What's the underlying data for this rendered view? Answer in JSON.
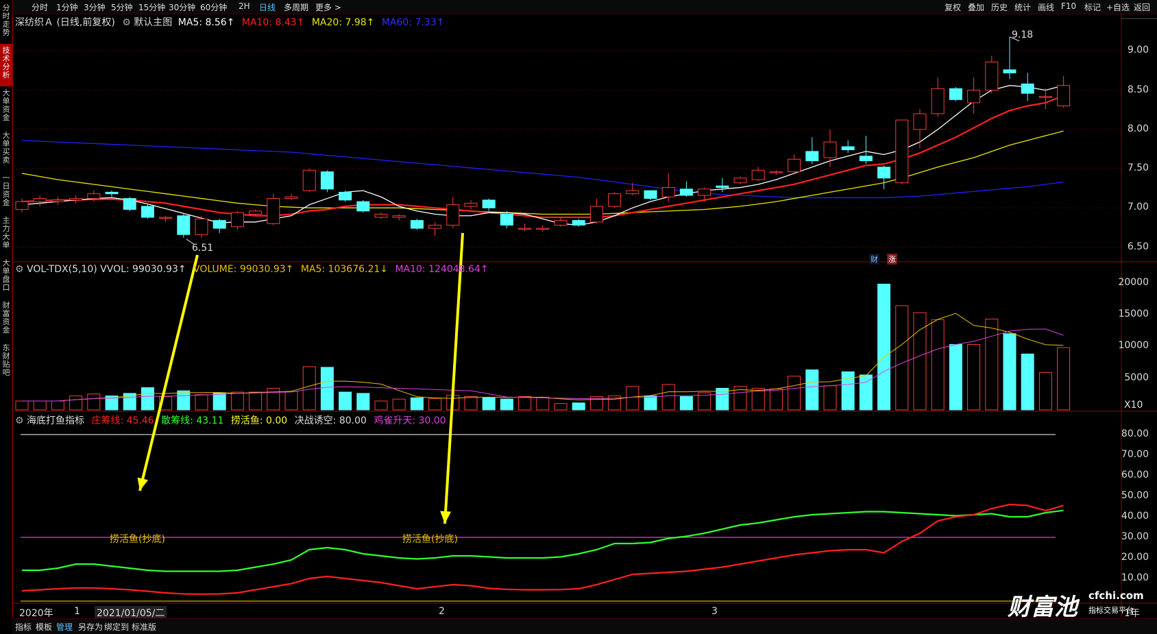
{
  "toolbar": {
    "timeframes": [
      "分时",
      "1分钟",
      "3分钟",
      "5分钟",
      "15分钟",
      "30分钟",
      "60分钟",
      "2H",
      "日线",
      "多周期",
      "更多 >"
    ],
    "active_timeframe": "日线",
    "right_buttons": [
      "复权",
      "叠加",
      "历史",
      "统计",
      "画线",
      "F10",
      "标记",
      "+自选",
      "返回"
    ]
  },
  "sidebar": {
    "items": [
      {
        "label": "分时走势",
        "active": false
      },
      {
        "label": "技术分析",
        "active": true
      },
      {
        "label": "大单资金",
        "active": false
      },
      {
        "label": "大单买卖",
        "active": false
      },
      {
        "label": "一日资金",
        "active": false
      },
      {
        "label": "主力大单",
        "active": false
      },
      {
        "label": "大单盘口",
        "active": false
      },
      {
        "label": "财富资金",
        "active": false
      },
      {
        "label": "东财贴吧",
        "active": false
      }
    ]
  },
  "price_panel": {
    "stock_name": "深纺织Ａ (日线,前复权)",
    "template": "默认主图",
    "ma5": "MA5: 8.56↑",
    "ma10": "MA10: 8.43↑",
    "ma20": "MA20: 7.98↑",
    "ma60": "MA60: 7.33↑",
    "axis": [
      "9.00",
      "8.50",
      "8.00",
      "7.50",
      "7.00",
      "6.50"
    ],
    "high_label": "9.18",
    "low_label": "6.51",
    "badges": [
      "财",
      "涨"
    ],
    "colors": {
      "up": "#ff3b3b",
      "down": "#54ffff",
      "ma5": "#ffffff",
      "ma10": "#ff2020",
      "ma20": "#e8e800",
      "ma60": "#2020ff"
    }
  },
  "volume_panel": {
    "title": "VOL-TDX(5,10) VVOL: 99030.93↑",
    "volume": "VOLUME: 99030.93↑",
    "ma5": "MA5: 103676.21↓",
    "ma10": "MA10: 124048.64↑",
    "axis": [
      "20000",
      "15000",
      "10000",
      "5000"
    ],
    "unit": "X10"
  },
  "indicator_panel": {
    "title": "海底打鱼指标",
    "zhuang": "庄筹线: 45.46",
    "san": "散筹线: 43.11",
    "laohuo": "捞活鱼: 0.00",
    "juezhan": "决战诱空: 80.00",
    "jique": "鸡雀升天: 30.00",
    "axis": [
      "80.00",
      "70.00",
      "60.00",
      "50.00",
      "40.00",
      "30.00",
      "20.00",
      "10.00"
    ],
    "annotation_label": "捞活鱼(抄底)",
    "annotations": [
      "捞活鱼(抄底)",
      "捞活鱼(抄底)"
    ]
  },
  "xaxis": {
    "labels": [
      "2020年",
      "1",
      "2021/01/05/二",
      "2",
      "3"
    ],
    "corner": "1年"
  },
  "bottom_tabs": [
    "指标",
    "模板",
    "管理",
    "另存为",
    "绑定到",
    "标准版"
  ],
  "active_bottom_tab": "管理",
  "watermark": {
    "brand": "财富池",
    "site": "cfchi.com",
    "slogan": "指标交易平台"
  },
  "chart_data": {
    "type": "candlestick",
    "candles": [
      [
        6.98,
        7.08,
        6.94,
        7.12
      ],
      [
        7.08,
        7.12,
        7.02,
        7.16
      ],
      [
        7.08,
        7.1,
        7.04,
        7.14
      ],
      [
        7.1,
        7.12,
        7.06,
        7.16
      ],
      [
        7.12,
        7.18,
        7.08,
        7.22
      ],
      [
        7.2,
        7.18,
        7.14,
        7.22
      ],
      [
        7.12,
        6.98,
        6.96,
        7.14
      ],
      [
        7.02,
        6.88,
        6.86,
        7.04
      ],
      [
        6.88,
        6.88,
        6.82,
        6.9
      ],
      [
        6.9,
        6.66,
        6.62,
        6.92
      ],
      [
        6.66,
        6.86,
        6.62,
        6.9
      ],
      [
        6.84,
        6.74,
        6.68,
        6.86
      ],
      [
        6.76,
        6.94,
        6.72,
        6.96
      ],
      [
        6.92,
        6.96,
        6.9,
        6.98
      ],
      [
        6.8,
        7.12,
        6.78,
        7.18
      ],
      [
        7.12,
        7.14,
        7.1,
        7.18
      ],
      [
        7.22,
        7.48,
        7.2,
        7.5
      ],
      [
        7.46,
        7.24,
        7.2,
        7.48
      ],
      [
        7.2,
        7.1,
        7.08,
        7.22
      ],
      [
        7.08,
        6.96,
        6.94,
        7.1
      ],
      [
        6.88,
        6.92,
        6.86,
        6.94
      ],
      [
        6.88,
        6.9,
        6.84,
        6.92
      ],
      [
        6.84,
        6.74,
        6.72,
        6.86
      ],
      [
        6.74,
        6.78,
        6.64,
        6.82
      ],
      [
        6.78,
        7.04,
        6.74,
        7.14
      ],
      [
        7.02,
        7.06,
        6.98,
        7.1
      ],
      [
        7.1,
        7.0,
        6.96,
        7.12
      ],
      [
        6.92,
        6.78,
        6.74,
        6.96
      ],
      [
        6.74,
        6.74,
        6.7,
        6.8
      ],
      [
        6.74,
        6.74,
        6.7,
        6.78
      ],
      [
        6.78,
        6.84,
        6.76,
        6.88
      ],
      [
        6.84,
        6.78,
        6.76,
        6.86
      ],
      [
        6.82,
        7.02,
        6.8,
        7.12
      ],
      [
        7.02,
        7.18,
        7.0,
        7.2
      ],
      [
        7.18,
        7.22,
        7.16,
        7.32
      ],
      [
        7.22,
        7.12,
        7.1,
        7.22
      ],
      [
        7.14,
        7.26,
        7.08,
        7.44
      ],
      [
        7.24,
        7.16,
        7.14,
        7.34
      ],
      [
        7.16,
        7.24,
        7.08,
        7.26
      ],
      [
        7.28,
        7.26,
        7.2,
        7.38
      ],
      [
        7.32,
        7.38,
        7.3,
        7.4
      ],
      [
        7.36,
        7.48,
        7.34,
        7.52
      ],
      [
        7.46,
        7.46,
        7.42,
        7.48
      ],
      [
        7.46,
        7.62,
        7.44,
        7.68
      ],
      [
        7.72,
        7.6,
        7.56,
        7.9
      ],
      [
        7.64,
        7.84,
        7.52,
        8.0
      ],
      [
        7.78,
        7.74,
        7.7,
        7.86
      ],
      [
        7.66,
        7.6,
        7.56,
        7.92
      ],
      [
        7.52,
        7.38,
        7.24,
        7.54
      ],
      [
        7.32,
        8.12,
        7.3,
        8.12
      ],
      [
        8.0,
        8.2,
        7.76,
        8.26
      ],
      [
        8.2,
        8.52,
        8.16,
        8.66
      ],
      [
        8.52,
        8.38,
        8.36,
        8.54
      ],
      [
        8.34,
        8.5,
        8.2,
        8.66
      ],
      [
        8.5,
        8.86,
        8.46,
        8.94
      ],
      [
        8.76,
        8.72,
        8.64,
        9.18
      ],
      [
        8.58,
        8.46,
        8.36,
        8.72
      ],
      [
        8.42,
        8.42,
        8.26,
        8.52
      ],
      [
        8.3,
        8.56,
        8.28,
        8.68
      ]
    ],
    "volumes": [
      14,
      14,
      14,
      22,
      25,
      22,
      26,
      35,
      21,
      30,
      24,
      27,
      28,
      28,
      34,
      29,
      68,
      67,
      28,
      26,
      14,
      17,
      19,
      18,
      23,
      21,
      19,
      17,
      21,
      20,
      10,
      11,
      21,
      22,
      37,
      22,
      40,
      21,
      27,
      34,
      37,
      34,
      33,
      53,
      63,
      38,
      60,
      55,
      198,
      164,
      153,
      142,
      103,
      103,
      143,
      120,
      88,
      59,
      98
    ],
    "ma5": [
      7.04,
      7.06,
      7.08,
      7.1,
      7.12,
      7.13,
      7.1,
      7.05,
      6.99,
      6.93,
      6.87,
      6.81,
      6.82,
      6.82,
      6.86,
      6.9,
      7.04,
      7.12,
      7.2,
      7.22,
      7.14,
      7.02,
      6.96,
      6.92,
      6.9,
      6.9,
      6.94,
      6.94,
      6.92,
      6.86,
      6.8,
      6.78,
      6.82,
      6.9,
      7.0,
      7.08,
      7.14,
      7.18,
      7.22,
      7.24,
      7.26,
      7.3,
      7.36,
      7.44,
      7.52,
      7.6,
      7.66,
      7.72,
      7.68,
      7.74,
      7.84,
      8.0,
      8.18,
      8.36,
      8.5,
      8.56,
      8.54,
      8.5,
      8.56
    ],
    "ma10": [
      7.08,
      7.09,
      7.1,
      7.1,
      7.11,
      7.11,
      7.1,
      7.08,
      7.06,
      7.02,
      6.98,
      6.94,
      6.92,
      6.9,
      6.9,
      6.92,
      6.96,
      6.98,
      7.02,
      7.04,
      7.04,
      7.04,
      7.02,
      7.0,
      6.98,
      6.96,
      6.94,
      6.92,
      6.9,
      6.88,
      6.88,
      6.88,
      6.88,
      6.9,
      6.94,
      6.98,
      7.02,
      7.06,
      7.1,
      7.14,
      7.18,
      7.22,
      7.26,
      7.3,
      7.36,
      7.42,
      7.48,
      7.54,
      7.56,
      7.62,
      7.7,
      7.8,
      7.9,
      8.02,
      8.14,
      8.24,
      8.3,
      8.34,
      8.43
    ],
    "ma20": [
      7.44,
      7.4,
      7.36,
      7.33,
      7.3,
      7.27,
      7.24,
      7.21,
      7.18,
      7.15,
      7.12,
      7.09,
      7.06,
      7.04,
      7.02,
      7.01,
      7.0,
      7.0,
      7.0,
      7.0,
      7.0,
      7.0,
      6.99,
      6.98,
      6.97,
      6.96,
      6.95,
      6.94,
      6.93,
      6.92,
      6.92,
      6.92,
      6.92,
      6.93,
      6.94,
      6.95,
      6.96,
      6.97,
      6.98,
      7.0,
      7.02,
      7.05,
      7.08,
      7.12,
      7.16,
      7.2,
      7.24,
      7.28,
      7.32,
      7.38,
      7.45,
      7.52,
      7.58,
      7.64,
      7.72,
      7.8,
      7.86,
      7.92,
      7.98
    ],
    "ma60": [
      7.86,
      7.85,
      7.84,
      7.83,
      7.82,
      7.81,
      7.8,
      7.79,
      7.78,
      7.77,
      7.76,
      7.75,
      7.74,
      7.73,
      7.72,
      7.71,
      7.69,
      7.67,
      7.65,
      7.63,
      7.61,
      7.59,
      7.57,
      7.55,
      7.53,
      7.51,
      7.49,
      7.47,
      7.45,
      7.43,
      7.41,
      7.39,
      7.36,
      7.33,
      7.3,
      7.27,
      7.24,
      7.21,
      7.19,
      7.17,
      7.16,
      7.15,
      7.14,
      7.13,
      7.13,
      7.13,
      7.13,
      7.13,
      7.13,
      7.14,
      7.15,
      7.17,
      7.19,
      7.21,
      7.23,
      7.25,
      7.27,
      7.3,
      7.33
    ],
    "zhuang_line": [
      4,
      4.5,
      5,
      5.4,
      5.4,
      5,
      4.5,
      3.8,
      3,
      2.5,
      2.4,
      2.5,
      3,
      4.5,
      6,
      7.5,
      10,
      11,
      10,
      9,
      8,
      6.5,
      5,
      6,
      7,
      6.5,
      5.2,
      4.7,
      4.5,
      4.5,
      4.6,
      5,
      7,
      9.5,
      12,
      12.5,
      13,
      13.5,
      14.5,
      15.5,
      17,
      18.5,
      20,
      21.5,
      22.5,
      23.5,
      24,
      24,
      22.5,
      28,
      32,
      38,
      40,
      41,
      44,
      46,
      45.5,
      43,
      45.46
    ],
    "san_line": [
      14,
      14,
      15,
      17,
      17,
      16,
      15,
      14,
      13.5,
      13.5,
      13.5,
      13.5,
      14,
      15.5,
      17,
      19,
      24,
      25,
      24,
      22,
      21,
      20,
      19.5,
      20,
      21,
      21,
      20.5,
      20,
      20,
      20,
      20.5,
      22,
      24,
      27,
      27,
      27.5,
      29.5,
      30.5,
      32,
      34,
      36,
      37,
      38.5,
      40,
      41,
      41.5,
      42,
      42.5,
      42.5,
      42,
      41.5,
      41,
      40.5,
      41,
      41.5,
      40,
      40,
      42,
      43.11
    ],
    "juezhan": 80,
    "jique": 30
  }
}
